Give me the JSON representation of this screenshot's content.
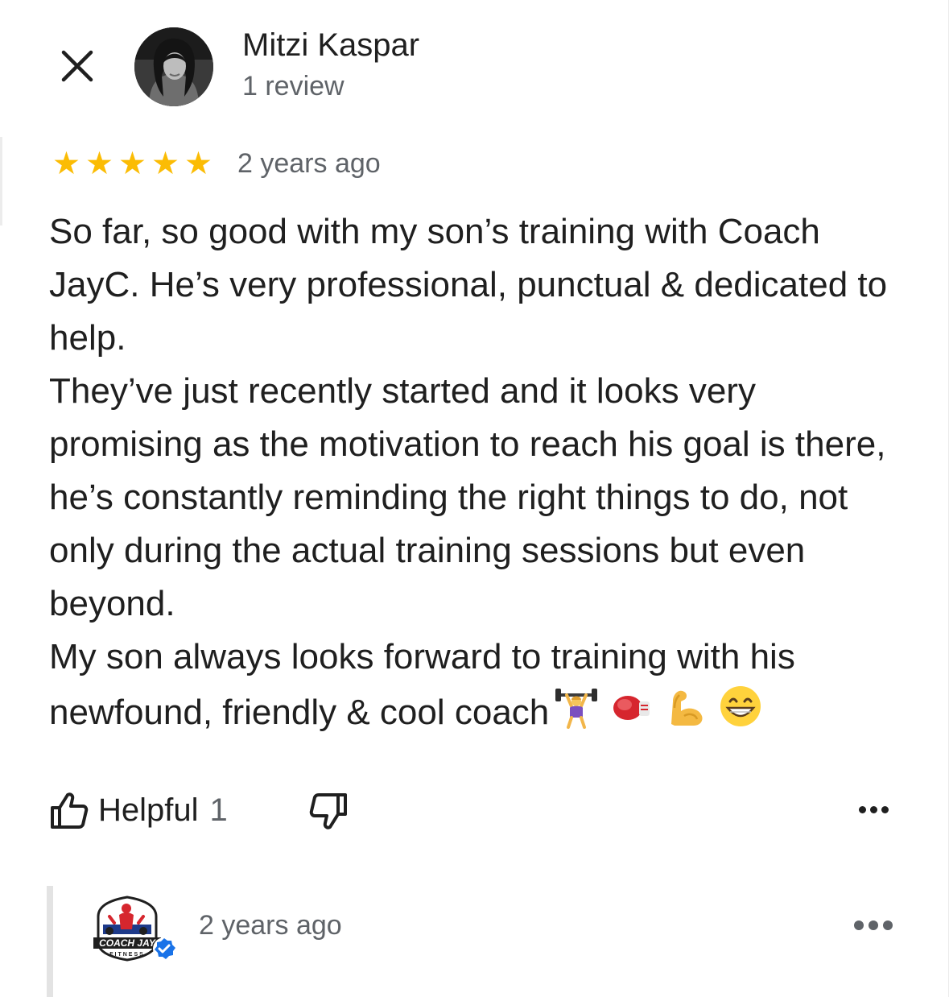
{
  "header": {
    "close_icon": "close-icon",
    "reviewer_name": "Mitzi Kaspar",
    "review_count": "1 review"
  },
  "review": {
    "rating": 5,
    "max_rating": 5,
    "star_glyph": "★",
    "star_color": "#fbbc04",
    "date": "2 years ago",
    "paragraphs": [
      "So far, so good with my son’s training with Coach JayC. He’s very professional, punctual & dedicated to help.",
      "They’ve just recently started and it looks very promising as the motivation to reach his goal is there, he’s constantly reminding the right things to do, not only during the actual training sessions but even beyond.",
      "My son always looks forward to training with his newfound, friendly & cool coach"
    ],
    "emojis": [
      "weightlifter-emoji",
      "boxing-glove-emoji",
      "flexed-biceps-emoji",
      "grinning-face-emoji"
    ]
  },
  "actions": {
    "helpful_label": "Helpful",
    "helpful_count": "1",
    "thumbs_up_icon": "thumbs-up-icon",
    "thumbs_down_icon": "thumbs-down-icon",
    "more_icon": "more-options-icon"
  },
  "owner_reply": {
    "logo_text": "COACH JAY",
    "logo_subtext": "FITNESS",
    "verified_icon": "verified-badge-icon",
    "date": "2 years ago",
    "more_icon": "more-options-icon"
  }
}
